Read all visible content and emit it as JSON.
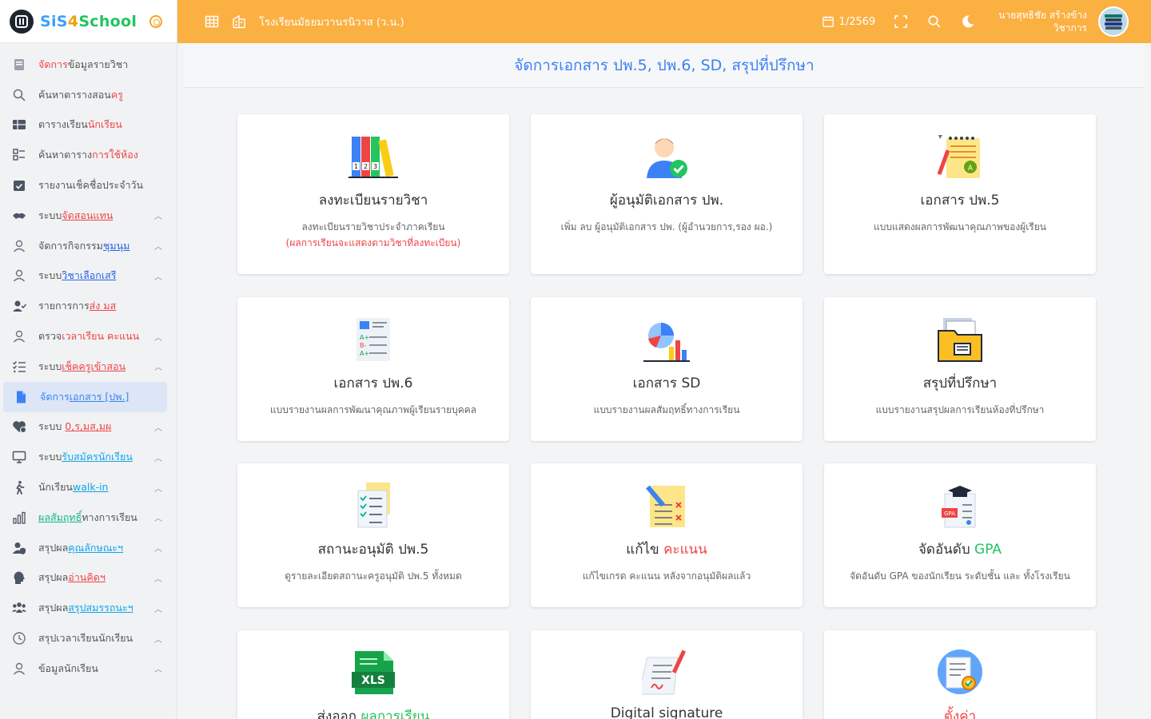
{
  "brand": {
    "name_p1": "SiS",
    "name_p2": "4",
    "name_p3": "School"
  },
  "topbar": {
    "school_name": "โรงเรียนมัธยมวานรนิวาส (ว.น.)",
    "term": "1/2569",
    "user_name": "นายสุทธิชัย สร้างข้าง",
    "user_role": "วิชาการ"
  },
  "sidebar": {
    "items": [
      {
        "pre": "",
        "hl": "จัดการ",
        "post": "ข้อมูลรายวิชา",
        "icon": "book-icon"
      },
      {
        "pre": "ค้นหาตารางสอน",
        "hl": "ครู",
        "post": "",
        "icon": "search-icon"
      },
      {
        "pre": "ตารางเรียน",
        "hl": "นักเรียน",
        "post": "",
        "icon": "table-icon"
      },
      {
        "pre": "ค้นหาตาราง",
        "hl": "การใช้ห้อง",
        "post": "",
        "icon": "grid-list-icon"
      },
      {
        "pre": "รายงานเช็คชื่อประจำวัน",
        "hl": "",
        "post": "",
        "icon": "calendar-check-icon"
      },
      {
        "pre": "ระบบ",
        "hl": "จัดสอนแทน",
        "post": "",
        "icon": "handshake-icon"
      },
      {
        "pre": "จัดการกิจกรรม",
        "hl": "ชุมนุม",
        "post": "",
        "icon": "user-icon"
      },
      {
        "pre": "ระบบ",
        "hl": "วิชาเลือกเสรี",
        "post": "",
        "icon": "user-icon"
      },
      {
        "pre": "รายการการ",
        "hl": "ส่ง มส",
        "post": "",
        "icon": "user-check-icon"
      },
      {
        "pre": "ตรวจ",
        "hl": "เวลาเรียน คะแนน",
        "post": "",
        "icon": "user-icon"
      },
      {
        "pre": "ระบบ",
        "hl": "เช็คครูเข้าสอน",
        "post": "",
        "icon": "checklist-icon"
      },
      {
        "pre": "จัดการ",
        "hl": "เอกสาร [ปพ.]",
        "post": "",
        "icon": "file-icon"
      },
      {
        "pre": "ระบบ ",
        "hl": "0,ร,มส,มผ",
        "post": "",
        "icon": "heart-icon"
      },
      {
        "pre": "ระบบ",
        "hl": "รับสมัครนักเรียน",
        "post": "",
        "icon": "monitor-icon"
      },
      {
        "pre": "นักเรียน",
        "hl": "walk-in",
        "post": "",
        "icon": "walking-icon"
      },
      {
        "pre": "",
        "hl": "ผลสัมฤทธิ์",
        "post": "ทางการเรียน",
        "icon": "bar-chart-icon"
      },
      {
        "pre": "สรุปผล",
        "hl": "คุณลักษณะฯ",
        "post": "",
        "icon": "user-shield-icon"
      },
      {
        "pre": "สรุปผล",
        "hl": "อ่านคิดฯ",
        "post": "",
        "icon": "head-speak-icon"
      },
      {
        "pre": "สรุปผล",
        "hl": "สรุปสมรรถนะฯ",
        "post": "",
        "icon": "users-icon"
      },
      {
        "pre": "สรุปเวลาเรียนนักเรียน",
        "hl": "",
        "post": "",
        "icon": "clock-icon"
      },
      {
        "pre": "ข้อมูลนักเรียน",
        "hl": "",
        "post": "",
        "icon": "user-icon"
      }
    ]
  },
  "main": {
    "title": "จัดการเอกสาร ปพ.5, ปพ.6, SD, สรุปที่ปรึกษา",
    "cards": [
      {
        "title": "ลงทะเบียนรายวิชา",
        "desc": "ลงทะเบียนรายวิชาประจำภาคเรียน",
        "desc2": "(ผลการเรียนจะแสดงตามวิชาที่ลงทะเบียน)",
        "icon": "books-icon"
      },
      {
        "title": "ผู้อนุมัติเอกสาร ปพ.",
        "desc": "เพิ่ม ลบ ผู้อนุมัติเอกสาร ปพ. (ผู้อำนวยการ,รอง ผอ.)",
        "icon": "approver-icon"
      },
      {
        "title": "เอกสาร ปพ.5",
        "desc": "แบบแสดงผลการพัฒนาคุณภาพของผู้เรียน",
        "icon": "notepad-icon"
      },
      {
        "title": "เอกสาร ปพ.6",
        "desc": "แบบรายงานผลการพัฒนาคุณภาพผู้เรียนรายบุคคล",
        "icon": "grade-sheet-icon"
      },
      {
        "title": "เอกสาร SD",
        "desc": "แบบรายงานผลสัมฤทธิ์ทางการเรียน",
        "icon": "analytics-icon"
      },
      {
        "title": "สรุปที่ปรึกษา",
        "desc": "แบบรายงานสรุปผลการเรียนห้องที่ปรึกษา",
        "icon": "folder-icon"
      },
      {
        "title": "สถานะอนุมัติ ปพ.5",
        "desc": "ดูรายละเอียดสถานะครูอนุมัติ ปพ.5 ทั้งหมด",
        "icon": "checklist-doc-icon"
      },
      {
        "title_pre": "แก้ไข ",
        "title_hl": "คะแนน",
        "desc": "แก้ไขเกรด คะแนน หลังจากอนุมัติผลแล้ว",
        "icon": "edit-doc-icon"
      },
      {
        "title_pre": "จัดอันดับ ",
        "title_hl": "GPA",
        "desc": "จัดอันดับ GPA ของนักเรียน ระดับชั้น และ ทั้งโรงเรียน",
        "icon": "gpa-icon"
      },
      {
        "title_pre": "ส่งออก ",
        "title_hl": "ผลการเรียน",
        "icon": "xls-icon"
      },
      {
        "title": "Digital signature",
        "icon": "signature-icon"
      },
      {
        "title": "ตั้งค่า",
        "icon": "settings-doc-icon"
      }
    ]
  }
}
